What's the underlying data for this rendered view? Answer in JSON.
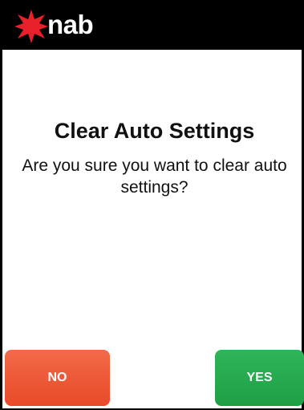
{
  "header": {
    "brand": "nab",
    "logo_icon": "nab-star-icon",
    "background_color": "#000000",
    "star_color": "#e8202a"
  },
  "dialog": {
    "title": "Clear Auto Settings",
    "message": "Are you sure you want to clear auto settings?"
  },
  "buttons": {
    "no_label": "NO",
    "no_color": "#ef5a38",
    "yes_label": "YES",
    "yes_color": "#27a84f"
  }
}
